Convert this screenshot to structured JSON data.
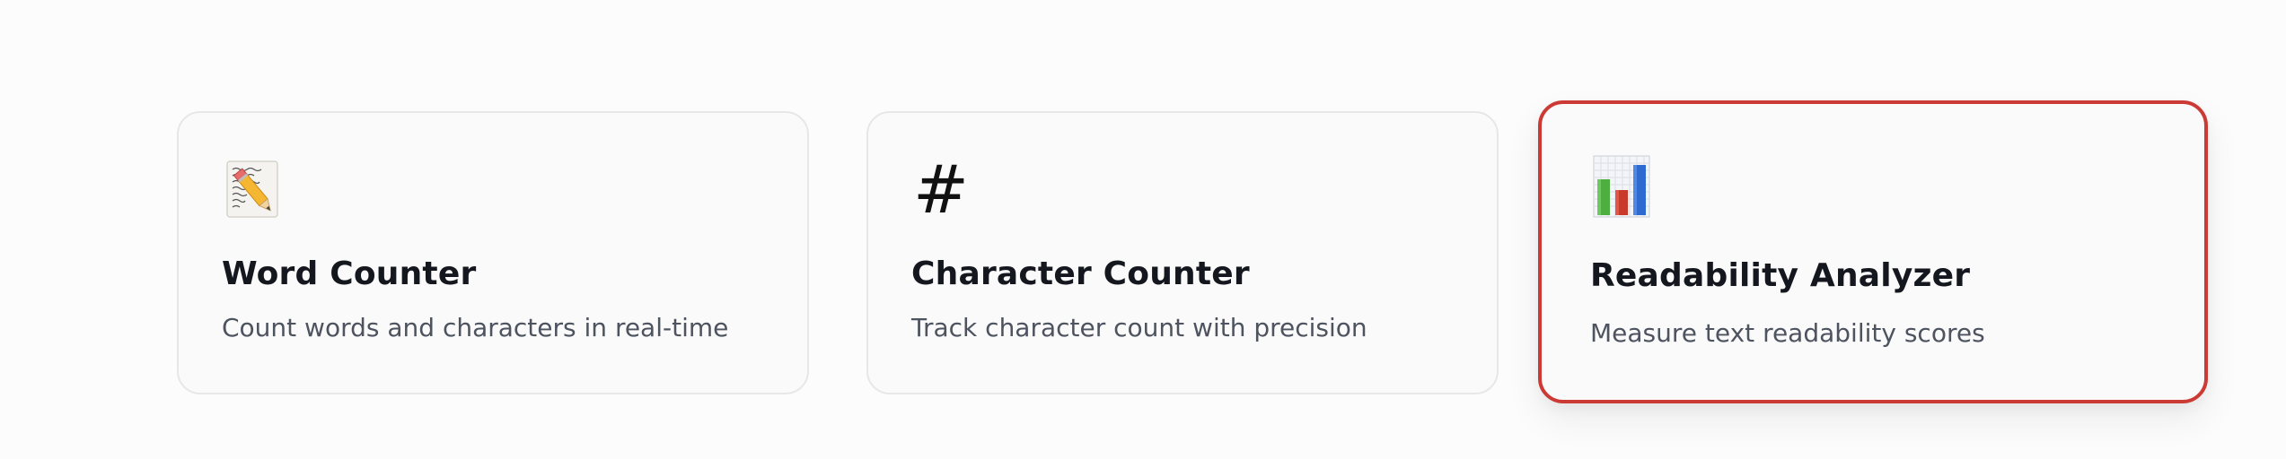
{
  "cards": [
    {
      "icon": "memo-pencil-icon",
      "title": "Word Counter",
      "description": "Count words and characters in real-time"
    },
    {
      "icon": "hash-icon",
      "icon_glyph": "#",
      "title": "Character Counter",
      "description": "Track character count with precision"
    },
    {
      "icon": "bar-chart-icon",
      "title": "Readability Analyzer",
      "description": "Measure text readability scores",
      "state": "selected",
      "border_color": "#cc3a35"
    }
  ],
  "colors": {
    "page_background": "#fcfcfc",
    "card_background": "#fafafa",
    "card_border": "#e7e7e9",
    "selected_border": "#cc3a35",
    "title_text": "#15171f",
    "description_text": "#4e5360",
    "chart_green": "#4caf3f",
    "chart_red": "#c93a2a",
    "chart_blue": "#2f6ad0"
  }
}
